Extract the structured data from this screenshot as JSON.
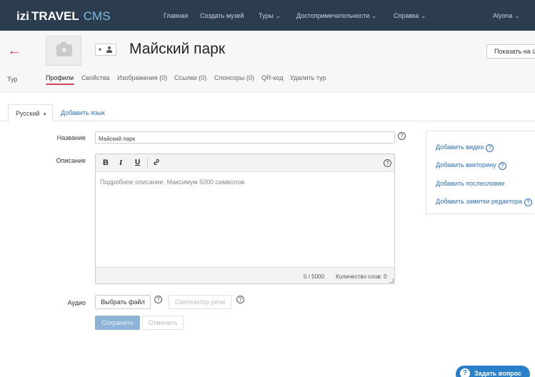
{
  "nav": {
    "logo_izi": "izi",
    "logo_travel": "TRAVEL",
    "logo_cms": "CMS",
    "items": [
      {
        "label": "Главная"
      },
      {
        "label": "Создать музей"
      },
      {
        "label": "Туры"
      },
      {
        "label": "Достопримечательности"
      },
      {
        "label": "Справка"
      }
    ],
    "user": "Alyona"
  },
  "header": {
    "back_label": "Тур",
    "title": "Майский парк",
    "show_button": "Показать на izi.TRAVEL",
    "tabs": [
      {
        "label": "Профили"
      },
      {
        "label": "Свойства"
      },
      {
        "label": "Изображения (0)"
      },
      {
        "label": "Ссылки (0)"
      },
      {
        "label": "Спонсоры (0)"
      },
      {
        "label": "QR-код"
      },
      {
        "label": "Удалить тур"
      }
    ],
    "active_tab": "Профили"
  },
  "language": {
    "current": "Русский",
    "add_label": "Добавить язык"
  },
  "form": {
    "name_label": "Название",
    "name_value": "Майский парк",
    "description_label": "Описание",
    "description_placeholder": "Подробное описание. Максимум 5000 символов.",
    "char_count": "0 / 5000",
    "word_count": "Количество слов: 0",
    "audio_label": "Аудио",
    "choose_file": "Выбрать файл",
    "speech_synth": "Синтезатор речи",
    "save": "Сохранить",
    "cancel": "Отменить",
    "help_glyph": "?"
  },
  "toolbar": {
    "bold": "B",
    "italic": "I",
    "underline": "U",
    "link": "🔗"
  },
  "side_panel": {
    "links": [
      {
        "label": "Добавить видео"
      },
      {
        "label": "Добавить викторину"
      },
      {
        "label": "Добавить послесловие"
      },
      {
        "label": "Добавить заметки редактора"
      }
    ]
  },
  "help_widget": {
    "label": "Задать вопрос"
  },
  "colors": {
    "nav_bg": "#2b3d4f",
    "accent": "#d9455f",
    "link": "#2a6ebb",
    "ask_button": "#2a80c8"
  }
}
